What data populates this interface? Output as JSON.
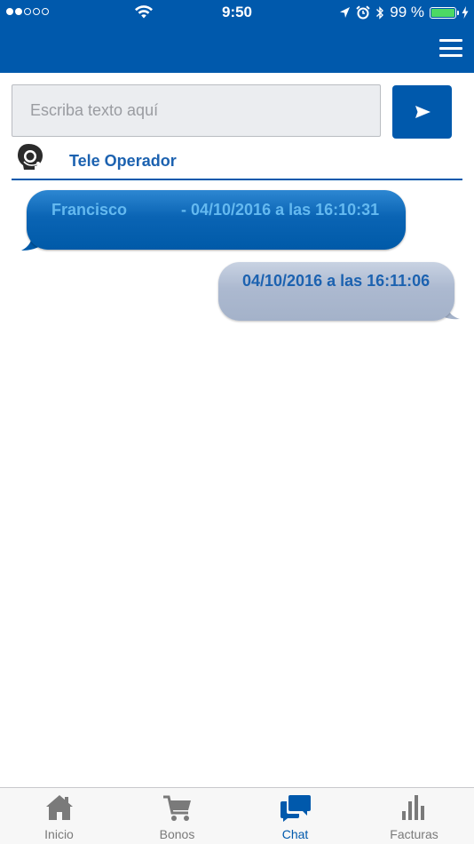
{
  "status_bar": {
    "time": "9:50",
    "battery_text": "99 %",
    "battery_level": 0.99,
    "signal_bars_filled": 2,
    "signal_bars_total": 5,
    "icons": [
      "signal-dots-icon",
      "wifi-icon",
      "location-arrow-icon",
      "alarm-clock-icon",
      "bluetooth-icon",
      "battery-icon",
      "charging-bolt-icon"
    ]
  },
  "header": {
    "menu_icon": "hamburger-menu-icon",
    "color": "#0059ac"
  },
  "composer": {
    "placeholder": "Escriba texto aquí",
    "value": "",
    "send_icon": "send-arrow-icon"
  },
  "operator": {
    "name": "Tele Operador",
    "icon": "headset-operator-icon"
  },
  "messages": [
    {
      "direction": "incoming",
      "sender": "Francisco",
      "time": "- 04/10/2016 a las 16:10:31"
    },
    {
      "direction": "outgoing",
      "time": "04/10/2016 a las 16:11:06"
    }
  ],
  "tabs": [
    {
      "label": "Inicio",
      "icon": "home-icon",
      "active": false
    },
    {
      "label": "Bonos",
      "icon": "shopping-cart-icon",
      "active": false
    },
    {
      "label": "Chat",
      "icon": "chat-bubbles-icon",
      "active": true
    },
    {
      "label": "Facturas",
      "icon": "bar-chart-icon",
      "active": false
    }
  ],
  "colors": {
    "brand_blue": "#0059ac",
    "label_blue": "#1c62b0",
    "incoming_text": "#64b9f0",
    "outgoing_bubble": "#a9b6cc",
    "tab_inactive": "#7a7a7a",
    "battery_green": "#4cd964"
  }
}
